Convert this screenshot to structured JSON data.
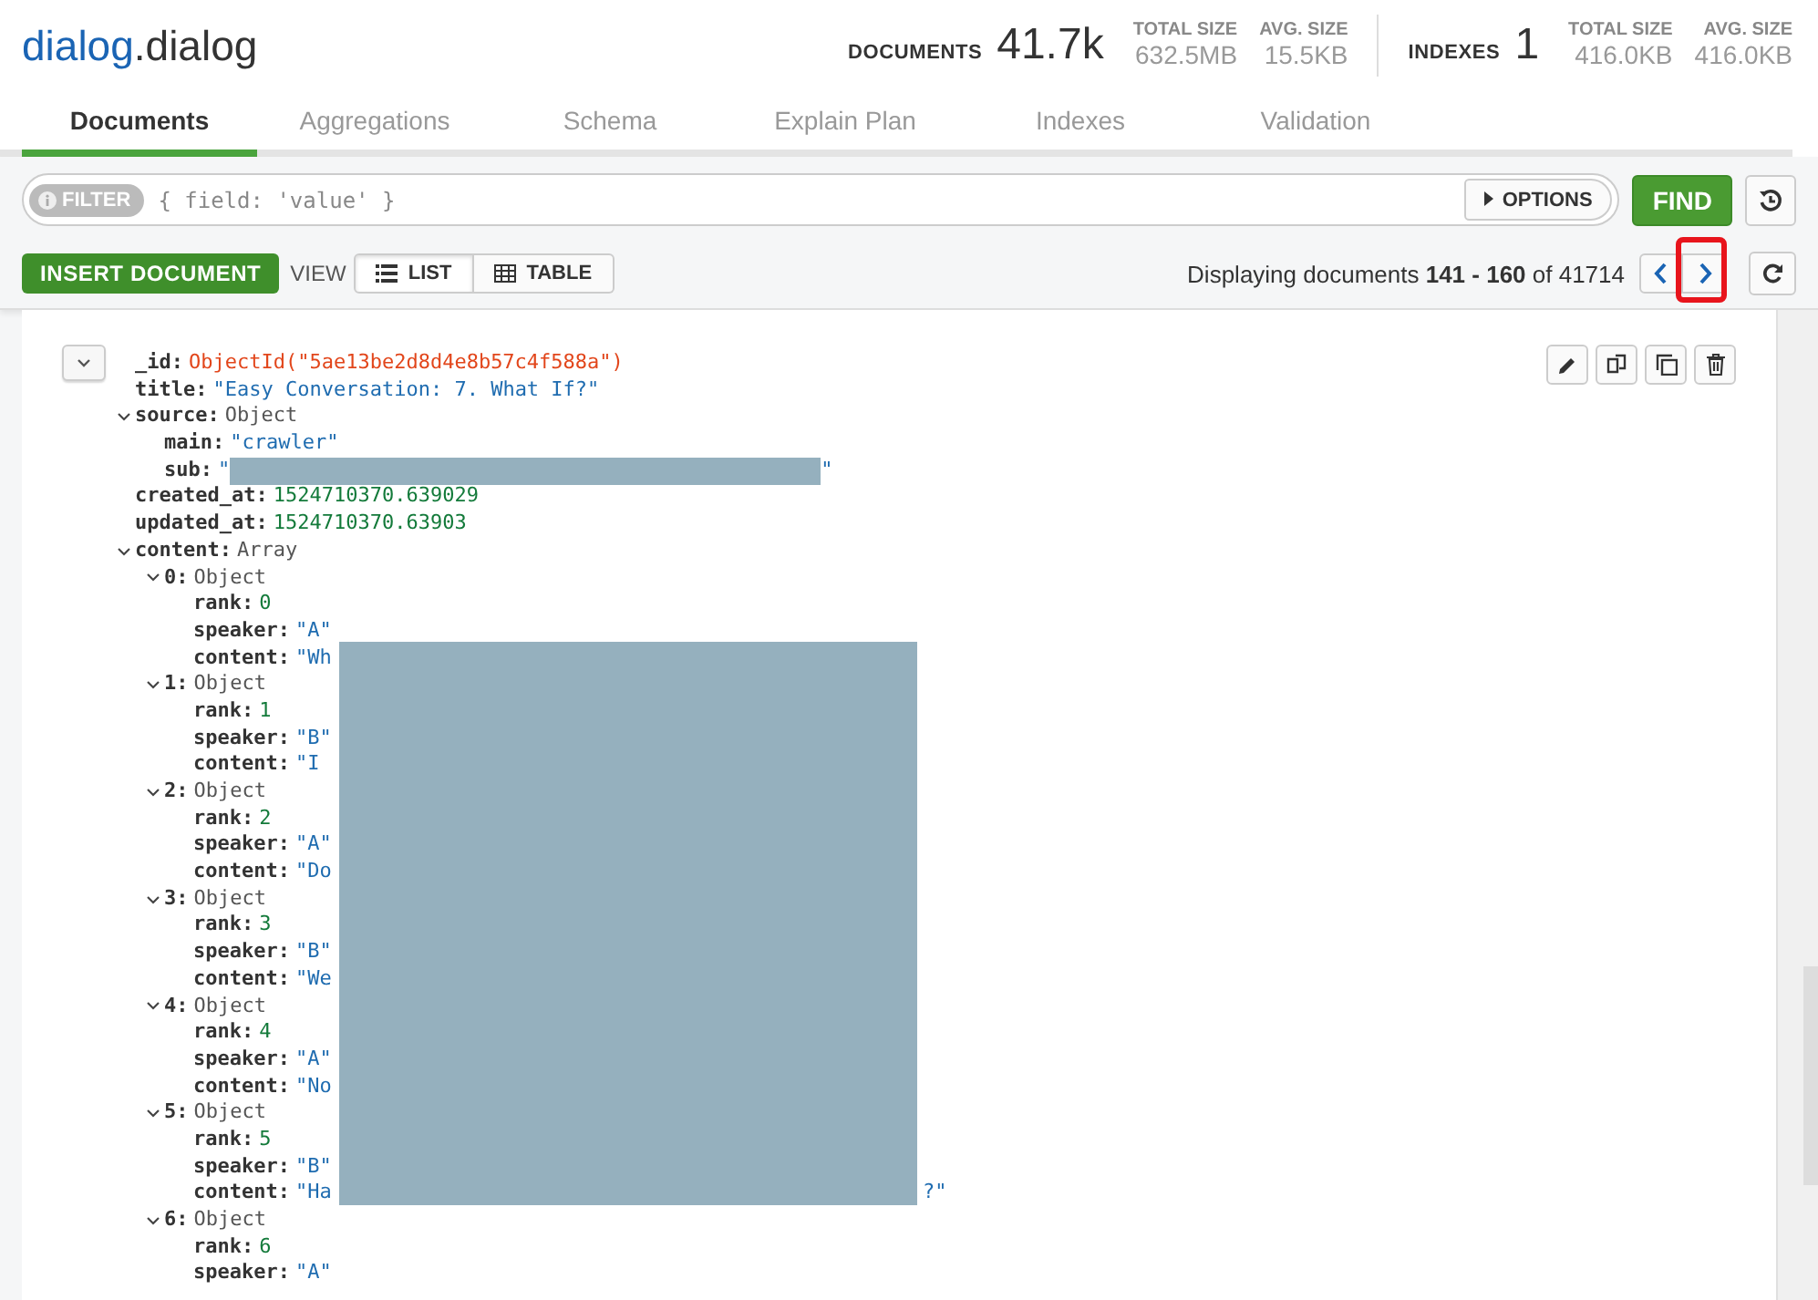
{
  "title": {
    "database": "dialog",
    "collection": ".dialog"
  },
  "stats": [
    {
      "label": "DOCUMENTS",
      "value": "41.7k",
      "details": [
        {
          "label": "TOTAL SIZE",
          "value": "632.5MB"
        },
        {
          "label": "AVG. SIZE",
          "value": "15.5KB"
        }
      ]
    },
    {
      "label": "INDEXES",
      "value": "1",
      "details": [
        {
          "label": "TOTAL SIZE",
          "value": "416.0KB"
        },
        {
          "label": "AVG. SIZE",
          "value": "416.0KB"
        }
      ]
    }
  ],
  "tabs": [
    {
      "label": "Documents",
      "selected": true
    },
    {
      "label": "Aggregations",
      "selected": false
    },
    {
      "label": "Schema",
      "selected": false
    },
    {
      "label": "Explain Plan",
      "selected": false
    },
    {
      "label": "Indexes",
      "selected": false
    },
    {
      "label": "Validation",
      "selected": false
    }
  ],
  "filter": {
    "badge": "FILTER",
    "placeholder": "{ field: 'value' }",
    "options": "OPTIONS",
    "find": "FIND"
  },
  "toolbar": {
    "insert": "INSERT DOCUMENT",
    "view_label": "VIEW",
    "views": [
      {
        "label": "LIST",
        "kind": "list",
        "selected": true
      },
      {
        "label": "TABLE",
        "kind": "table",
        "selected": false
      }
    ]
  },
  "pager": {
    "text": "Displaying documents **141 - 160** of 41714",
    "next_highlighted": true
  },
  "document": {
    "expanded": true,
    "fields": [
      {
        "key": "_id:",
        "kind": "objectid",
        "value": "ObjectId(\"5ae13be2d8d4e8b57c4f588a\")"
      },
      {
        "key": "title:",
        "kind": "string",
        "value": "\"Easy Conversation: 7. What If?\""
      },
      {
        "key": "source:",
        "kind": "object",
        "value": "Object",
        "expanded": true,
        "children": [
          {
            "key": "main:",
            "kind": "string",
            "value": "\"crawler\""
          },
          {
            "key": "sub:",
            "kind": "string",
            "value": "\"",
            "redacted": true,
            "tail": "\""
          }
        ]
      },
      {
        "key": "created_at:",
        "kind": "number",
        "value": "1524710370.639029"
      },
      {
        "key": "updated_at:",
        "kind": "number",
        "value": "1524710370.63903"
      },
      {
        "key": "content:",
        "kind": "array",
        "value": "Array",
        "expanded": true,
        "children": [
          {
            "key": "0:",
            "kind": "object",
            "value": "Object",
            "expanded": true,
            "children": [
              {
                "key": "rank:",
                "kind": "number",
                "value": "0"
              },
              {
                "key": "speaker:",
                "kind": "string",
                "value": "\"A\""
              },
              {
                "key": "content:",
                "kind": "string",
                "value": "\"Wh"
              }
            ]
          },
          {
            "key": "1:",
            "kind": "object",
            "value": "Object",
            "expanded": true,
            "children": [
              {
                "key": "rank:",
                "kind": "number",
                "value": "1"
              },
              {
                "key": "speaker:",
                "kind": "string",
                "value": "\"B\""
              },
              {
                "key": "content:",
                "kind": "string",
                "value": "\"I"
              }
            ]
          },
          {
            "key": "2:",
            "kind": "object",
            "value": "Object",
            "expanded": true,
            "children": [
              {
                "key": "rank:",
                "kind": "number",
                "value": "2"
              },
              {
                "key": "speaker:",
                "kind": "string",
                "value": "\"A\""
              },
              {
                "key": "content:",
                "kind": "string",
                "value": "\"Do"
              }
            ]
          },
          {
            "key": "3:",
            "kind": "object",
            "value": "Object",
            "expanded": true,
            "children": [
              {
                "key": "rank:",
                "kind": "number",
                "value": "3"
              },
              {
                "key": "speaker:",
                "kind": "string",
                "value": "\"B\""
              },
              {
                "key": "content:",
                "kind": "string",
                "value": "\"We"
              }
            ]
          },
          {
            "key": "4:",
            "kind": "object",
            "value": "Object",
            "expanded": true,
            "children": [
              {
                "key": "rank:",
                "kind": "number",
                "value": "4"
              },
              {
                "key": "speaker:",
                "kind": "string",
                "value": "\"A\""
              },
              {
                "key": "content:",
                "kind": "string",
                "value": "\"No"
              }
            ]
          },
          {
            "key": "5:",
            "kind": "object",
            "value": "Object",
            "expanded": true,
            "children": [
              {
                "key": "rank:",
                "kind": "number",
                "value": "5"
              },
              {
                "key": "speaker:",
                "kind": "string",
                "value": "\"B\""
              },
              {
                "key": "content:",
                "kind": "string",
                "value": "\"Ha",
                "tail": "?\""
              }
            ]
          },
          {
            "key": "6:",
            "kind": "object",
            "value": "Object",
            "expanded": true,
            "children": [
              {
                "key": "rank:",
                "kind": "number",
                "value": "6"
              },
              {
                "key": "speaker:",
                "kind": "string",
                "value": "\"A\""
              }
            ]
          }
        ]
      }
    ]
  }
}
